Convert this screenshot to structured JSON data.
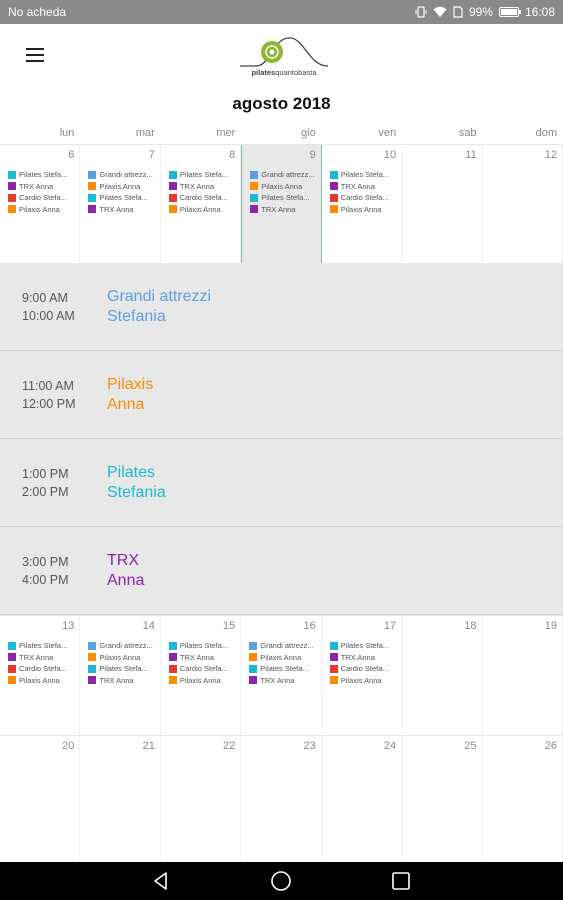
{
  "status": {
    "carrier": "No acheda",
    "battery": "99%",
    "battery_level": 0.99,
    "time": "16:08",
    "icons": [
      "vibrate-icon",
      "wifi-icon",
      "sim-icon",
      "battery-icon"
    ]
  },
  "appbar": {
    "menu_icon": "hamburger-menu-icon",
    "logo_text_bold": "pilates",
    "logo_text": "quantobasta",
    "logo_color": "#8fb82e"
  },
  "calendar": {
    "month_title": "agosto 2018",
    "weekdays": [
      "lun",
      "mar",
      "mer",
      "gio",
      "ven",
      "sab",
      "dom"
    ],
    "weeks": [
      {
        "days": [
          {
            "num": "6",
            "events": [
              {
                "label": "Pilates Stefa...",
                "color": "#1bb9d2"
              },
              {
                "label": "TRX Anna",
                "color": "#8e24aa"
              },
              {
                "label": "Cardio Stefa...",
                "color": "#e53935"
              },
              {
                "label": "Pilaxis Anna",
                "color": "#fb8c00"
              }
            ]
          },
          {
            "num": "7",
            "events": [
              {
                "label": "Grandi attrezz...",
                "color": "#5b9fe3"
              },
              {
                "label": "Pilaxis Anna",
                "color": "#fb8c00"
              },
              {
                "label": "Pilates Stefa...",
                "color": "#1bb9d2"
              },
              {
                "label": "TRX Anna",
                "color": "#8e24aa"
              }
            ]
          },
          {
            "num": "8",
            "events": [
              {
                "label": "Pilates Stefa...",
                "color": "#1bb9d2"
              },
              {
                "label": "TRX Anna",
                "color": "#8e24aa"
              },
              {
                "label": "Cardio Stefa...",
                "color": "#e53935"
              },
              {
                "label": "Pilaxis Anna",
                "color": "#fb8c00"
              }
            ]
          },
          {
            "num": "9",
            "selected": true,
            "events": [
              {
                "label": "Grandi attrezz...",
                "color": "#5b9fe3"
              },
              {
                "label": "Pilaxis Anna",
                "color": "#fb8c00"
              },
              {
                "label": "Pilates Stefa...",
                "color": "#1bb9d2"
              },
              {
                "label": "TRX Anna",
                "color": "#8e24aa"
              }
            ]
          },
          {
            "num": "10",
            "events": [
              {
                "label": "Pilates Stefa...",
                "color": "#1bb9d2"
              },
              {
                "label": "TRX Anna",
                "color": "#8e24aa"
              },
              {
                "label": "Cardio Stefa...",
                "color": "#e53935"
              },
              {
                "label": "Pilaxis Anna",
                "color": "#fb8c00"
              }
            ]
          },
          {
            "num": "11",
            "events": []
          },
          {
            "num": "12",
            "events": []
          }
        ]
      },
      {
        "days": [
          {
            "num": "13",
            "events": [
              {
                "label": "Pilates Stefa...",
                "color": "#1bb9d2"
              },
              {
                "label": "TRX Anna",
                "color": "#8e24aa"
              },
              {
                "label": "Cardio Stefa...",
                "color": "#e53935"
              },
              {
                "label": "Pilaxis Anna",
                "color": "#fb8c00"
              }
            ]
          },
          {
            "num": "14",
            "events": [
              {
                "label": "Grandi attrezz...",
                "color": "#5b9fe3"
              },
              {
                "label": "Pilaxis Anna",
                "color": "#fb8c00"
              },
              {
                "label": "Pilates Stefa...",
                "color": "#1bb9d2"
              },
              {
                "label": "TRX Anna",
                "color": "#8e24aa"
              }
            ]
          },
          {
            "num": "15",
            "events": [
              {
                "label": "Pilates Stefa...",
                "color": "#1bb9d2"
              },
              {
                "label": "TRX Anna",
                "color": "#8e24aa"
              },
              {
                "label": "Cardio Stefa...",
                "color": "#e53935"
              },
              {
                "label": "Pilaxis Anna",
                "color": "#fb8c00"
              }
            ]
          },
          {
            "num": "16",
            "events": [
              {
                "label": "Grandi attrezz...",
                "color": "#5b9fe3"
              },
              {
                "label": "Pilaxis Anna",
                "color": "#fb8c00"
              },
              {
                "label": "Pilates Stefa...",
                "color": "#1bb9d2"
              },
              {
                "label": "TRX Anna",
                "color": "#8e24aa"
              }
            ]
          },
          {
            "num": "17",
            "events": [
              {
                "label": "Pilates Stefa...",
                "color": "#1bb9d2"
              },
              {
                "label": "TRX Anna",
                "color": "#8e24aa"
              },
              {
                "label": "Cardio Stefa...",
                "color": "#e53935"
              },
              {
                "label": "Pilaxis Anna",
                "color": "#fb8c00"
              }
            ]
          },
          {
            "num": "18",
            "events": []
          },
          {
            "num": "19",
            "events": []
          }
        ]
      },
      {
        "days": [
          {
            "num": "20",
            "events": []
          },
          {
            "num": "21",
            "events": []
          },
          {
            "num": "22",
            "events": []
          },
          {
            "num": "23",
            "events": []
          },
          {
            "num": "24",
            "events": []
          },
          {
            "num": "25",
            "events": []
          },
          {
            "num": "26",
            "events": []
          }
        ]
      }
    ]
  },
  "schedule": [
    {
      "start": "9:00 AM",
      "end": "10:00 AM",
      "title": "Grandi attrezzi",
      "instructor": "Stefania",
      "color": "#5b9fe3"
    },
    {
      "start": "11:00 AM",
      "end": "12:00 PM",
      "title": "Pilaxis",
      "instructor": "Anna",
      "color": "#fb8c00"
    },
    {
      "start": "1:00 PM",
      "end": "2:00 PM",
      "title": "Pilates",
      "instructor": "Stefania",
      "color": "#1bb9d2"
    },
    {
      "start": "3:00 PM",
      "end": "4:00 PM",
      "title": "TRX",
      "instructor": "Anna",
      "color": "#8e24aa"
    }
  ],
  "navbar": {
    "buttons": [
      "back-icon",
      "home-icon",
      "recents-icon"
    ]
  }
}
